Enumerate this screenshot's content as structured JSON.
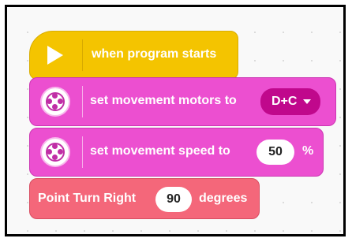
{
  "blocks": {
    "start": {
      "label": "when program starts",
      "icon": "play-icon",
      "color": "#f4c400"
    },
    "motors": {
      "label": "set movement motors to",
      "value": "D+C",
      "icon": "motor-icon",
      "color": "#ec4fd0",
      "dropdown_color": "#c0088c"
    },
    "speed": {
      "label": "set movement speed to",
      "value": "50",
      "unit": "%",
      "icon": "motor-icon",
      "color": "#ec4fd0"
    },
    "turn": {
      "label": "Point Turn Right",
      "value": "90",
      "unit": "degrees",
      "color": "#f4677a"
    }
  }
}
